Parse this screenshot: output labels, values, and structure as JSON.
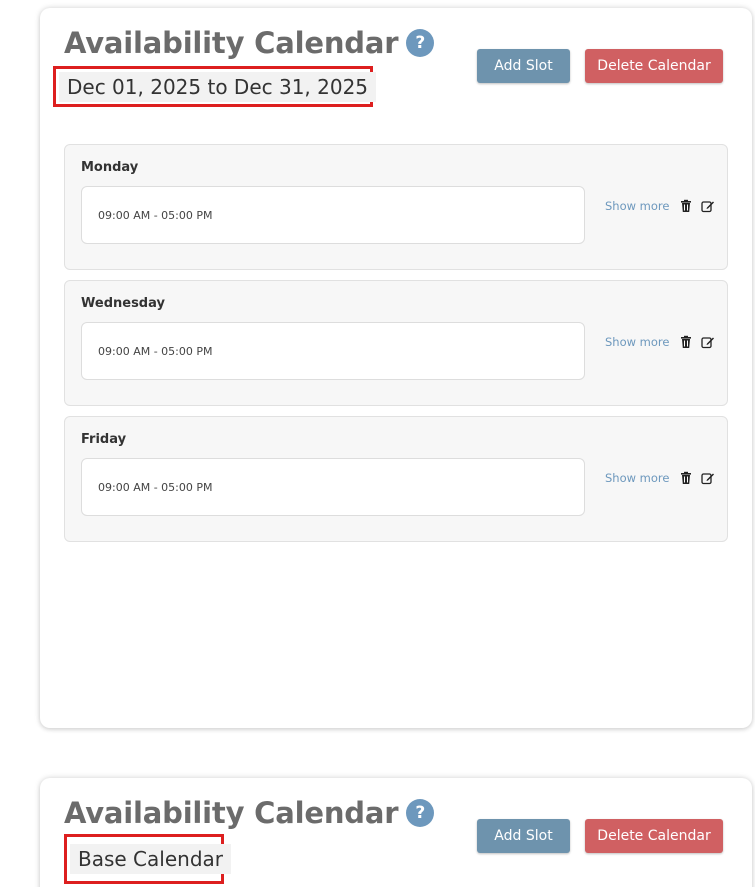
{
  "calendars": [
    {
      "title": "Availability Calendar",
      "help_icon": "?",
      "range": "Dec 01, 2025 to Dec 31, 2025",
      "add_slot_label": "Add Slot",
      "delete_label": "Delete Calendar",
      "days": [
        {
          "name": "Monday",
          "slot": "09:00 AM - 05:00 PM",
          "show_more": "Show more"
        },
        {
          "name": "Wednesday",
          "slot": "09:00 AM - 05:00 PM",
          "show_more": "Show more"
        },
        {
          "name": "Friday",
          "slot": "09:00 AM - 05:00 PM",
          "show_more": "Show more"
        }
      ]
    },
    {
      "title": "Availability Calendar",
      "help_icon": "?",
      "range": "Base Calendar",
      "add_slot_label": "Add Slot",
      "delete_label": "Delete Calendar"
    }
  ],
  "colors": {
    "help_icon": "#6d98bd",
    "add_slot_button": "#6e93ad",
    "delete_button": "#d06062",
    "highlight_border": "#dd1f1f",
    "show_more_link": "#6d98bd"
  },
  "icons": [
    "help-icon",
    "trash-icon",
    "edit-icon"
  ]
}
